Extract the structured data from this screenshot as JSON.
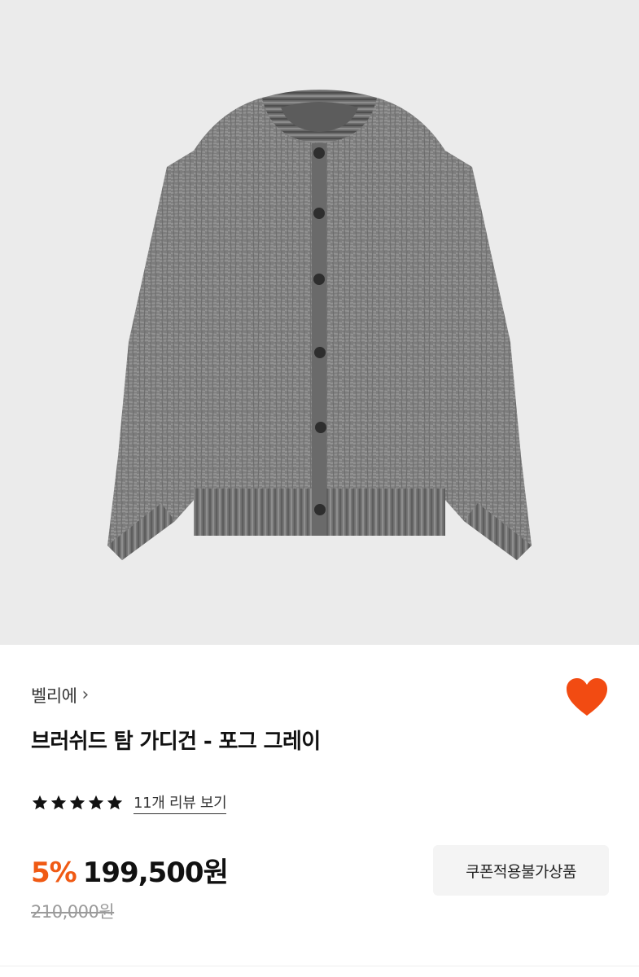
{
  "product_image": {
    "alt": "cardigan",
    "icon": "cardigan-photo"
  },
  "brand": {
    "name": "벨리에",
    "chevron": "›"
  },
  "wishlist": {
    "icon": "heart-icon",
    "color": "#f24b12",
    "active": true
  },
  "product": {
    "title": "브러쉬드 탐 가디건 - 포그 그레이"
  },
  "rating": {
    "stars": 5,
    "review_link": "11개 리뷰 보기"
  },
  "pricing": {
    "discount": "5%",
    "discount_color": "#f05a14",
    "price": "199,500원",
    "original_price": "210,000원"
  },
  "coupon": {
    "label": "쿠폰적용불가상품"
  }
}
